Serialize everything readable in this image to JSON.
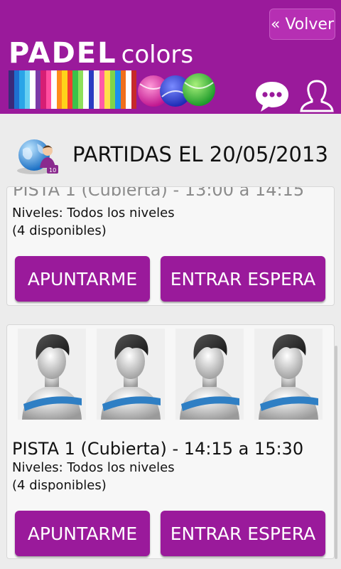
{
  "header": {
    "back_label": "« Volver",
    "brand_bold": "PADEL",
    "brand_light": "colors",
    "stripe_colors": [
      "#3a2a7a",
      "#1e6fd0",
      "#2aa5e8",
      "#68d0f2",
      "#ffffff",
      "#7c3aa8",
      "#d61e74",
      "#ff4da0",
      "#ffffff",
      "#ff8c1a",
      "#ffd21a",
      "#f23c2f",
      "#3bc24a",
      "#8ee05a",
      "#ffffff",
      "#2a3cc2",
      "#f4f4f4",
      "#ff5aa8",
      "#ffe04a",
      "#7fd44a",
      "#1b8ef0",
      "#f06f1c",
      "#ffffff",
      "#c62a2a"
    ]
  },
  "page": {
    "title": "PARTIDAS EL 20/05/2013"
  },
  "cards": [
    {
      "title": "PISTA 1  (Cubierta) - 13:00 a 14:15",
      "levels": "Niveles: Todos los niveles",
      "available": "(4 disponibles)",
      "join_label": "APUNTARME",
      "wait_label": "ENTRAR ESPERA"
    },
    {
      "title": "PISTA 1  (Cubierta) - 14:15 a 15:30",
      "levels": "Niveles: Todos los niveles",
      "available": "(4 disponibles)",
      "join_label": "APUNTARME",
      "wait_label": "ENTRAR ESPERA"
    }
  ],
  "colors": {
    "accent": "#9a1a9b",
    "background": "#ececec"
  }
}
